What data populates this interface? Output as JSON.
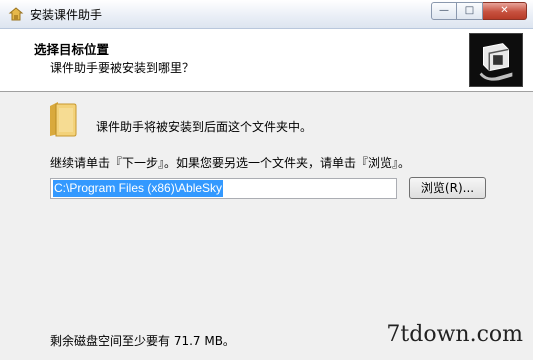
{
  "window": {
    "title": "安装课件助手",
    "buttons": {
      "minimize": "—",
      "maximize": "□",
      "close": "✕"
    }
  },
  "header": {
    "title": "选择目标位置",
    "subtitle": "课件助手要被安装到哪里？"
  },
  "main": {
    "info_line1": "课件助手将被安装到后面这个文件夹中。",
    "info_line2": "继续请单击『下一步』。如果您要另选一个文件夹，请单击『浏览』。",
    "path_value": "C:\\Program Files (x86)\\AbleSky",
    "browse_label": "浏览(R)...",
    "disk_space": "剩余磁盘空间至少要有 71.7 MB。"
  },
  "watermark": "7tdown.com"
}
